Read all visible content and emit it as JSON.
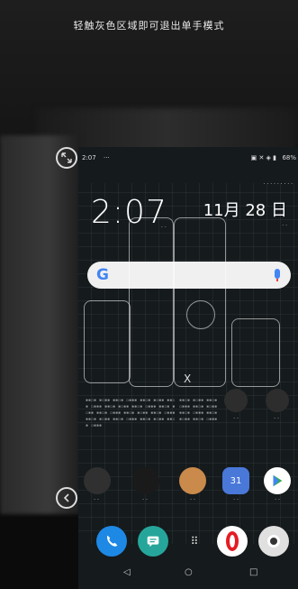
{
  "hint": "轻触灰色区域即可退出单手模式",
  "status": {
    "time": "2:07",
    "battery": "68%"
  },
  "lock": {
    "clock": "2:07",
    "date": "11月 28 日"
  },
  "search": {
    "logo": "G"
  },
  "icons": {
    "resize": "resize-arrows-icon",
    "back": "chevron-left-icon",
    "phone": "phone-icon",
    "messages": "messages-icon",
    "app_drawer": "app-drawer-icon",
    "opera": "opera-icon",
    "camera": "camera-icon",
    "calendar": "calendar-icon",
    "play_store": "play-store-icon",
    "box": "package-icon"
  },
  "calendar_day": "31",
  "widget_x": "X",
  "nav": {
    "back": "◁",
    "home": "○",
    "recents": "□"
  },
  "colors": {
    "accent": "#4285f4",
    "phone": "#1e88e5",
    "messages": "#26a69a",
    "opera": "#e51c23"
  }
}
